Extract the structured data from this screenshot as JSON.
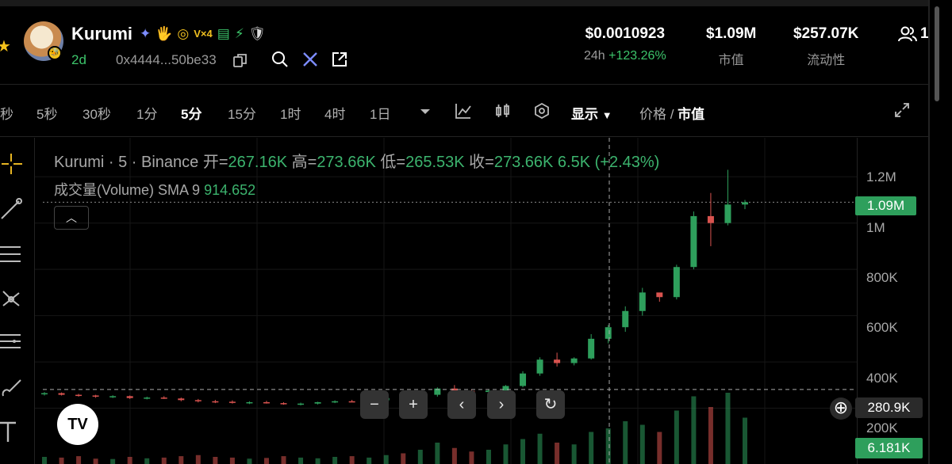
{
  "token": {
    "name": "Kurumi",
    "age": "2d",
    "address": "0x4444...50be33",
    "avatar_badge": "🐝"
  },
  "badges": [
    "✦",
    "🖐",
    "◎",
    "V×4",
    "▤",
    "⚡",
    "🛡"
  ],
  "stats": {
    "price": "$0.0010923",
    "change_label": "24h",
    "change_value": "+123.26%",
    "market_cap": "$1.09M",
    "market_cap_label": "市值",
    "liquidity": "$257.07K",
    "liquidity_label": "流动性",
    "holders": "1"
  },
  "toolbar": {
    "timeframes": [
      "秒",
      "5秒",
      "30秒",
      "1分",
      "5分",
      "15分",
      "1时",
      "4时",
      "1日"
    ],
    "active_timeframe": "5分",
    "display_label": "显示",
    "price_label": "价格",
    "mc_label": "市值"
  },
  "legend": {
    "symbol": "Kurumi · 5 · Binance",
    "open_label": "开=",
    "open": "267.16K",
    "high_label": "高=",
    "high": "273.66K",
    "low_label": "低=",
    "low": "265.53K",
    "close_label": "收=",
    "close": "273.66K",
    "change": "6.5K (+2.43%)",
    "volume_label": "成交量(Volume) SMA 9",
    "volume_value": "914.652"
  },
  "axis": {
    "ticks": [
      "1.2M",
      "1M",
      "800K",
      "600K",
      "400K",
      "200K"
    ],
    "current_price": "1.09M",
    "crosshair_value": "280.9K",
    "volume_current": "6.181K"
  },
  "colors": {
    "up": "#2e9f5c",
    "down": "#d9534f",
    "accent_green": "#3cc36a"
  },
  "chart_data": {
    "type": "candlestick",
    "title": "Kurumi · 5 · Binance",
    "ylim": [
      0,
      1300000
    ],
    "y_ticks": [
      200000,
      400000,
      600000,
      800000,
      1000000,
      1200000
    ],
    "ohlc": [
      [
        260000,
        270000,
        255000,
        265000
      ],
      [
        265000,
        268000,
        255000,
        258000
      ],
      [
        258000,
        262000,
        250000,
        255000
      ],
      [
        255000,
        258000,
        245000,
        250000
      ],
      [
        250000,
        256000,
        244000,
        252000
      ],
      [
        252000,
        255000,
        240000,
        244000
      ],
      [
        244000,
        250000,
        238000,
        246000
      ],
      [
        246000,
        252000,
        240000,
        242000
      ],
      [
        242000,
        246000,
        230000,
        235000
      ],
      [
        235000,
        240000,
        225000,
        230000
      ],
      [
        230000,
        236000,
        222000,
        228000
      ],
      [
        228000,
        234000,
        220000,
        224000
      ],
      [
        224000,
        230000,
        218000,
        226000
      ],
      [
        226000,
        232000,
        220000,
        222000
      ],
      [
        222000,
        226000,
        215000,
        218000
      ],
      [
        218000,
        224000,
        212000,
        220000
      ],
      [
        220000,
        228000,
        216000,
        226000
      ],
      [
        226000,
        234000,
        222000,
        230000
      ],
      [
        230000,
        236000,
        226000,
        228000
      ],
      [
        228000,
        236000,
        224000,
        234000
      ],
      [
        234000,
        246000,
        230000,
        244000
      ],
      [
        244000,
        252000,
        238000,
        240000
      ],
      [
        240000,
        262000,
        238000,
        258000
      ],
      [
        258000,
        290000,
        250000,
        285000
      ],
      [
        285000,
        300000,
        270000,
        275000
      ],
      [
        275000,
        282000,
        265000,
        270000
      ],
      [
        270000,
        280000,
        262000,
        276000
      ],
      [
        276000,
        300000,
        272000,
        296000
      ],
      [
        296000,
        360000,
        290000,
        350000
      ],
      [
        350000,
        420000,
        340000,
        410000
      ],
      [
        410000,
        440000,
        380000,
        395000
      ],
      [
        395000,
        420000,
        385000,
        415000
      ],
      [
        415000,
        520000,
        410000,
        500000
      ],
      [
        500000,
        560000,
        480000,
        550000
      ],
      [
        550000,
        640000,
        530000,
        620000
      ],
      [
        620000,
        720000,
        600000,
        700000
      ],
      [
        700000,
        690000,
        660000,
        680000
      ],
      [
        680000,
        820000,
        670000,
        810000
      ],
      [
        810000,
        1050000,
        800000,
        1030000
      ],
      [
        1030000,
        1130000,
        900000,
        1000000
      ],
      [
        1000000,
        1230000,
        990000,
        1080000
      ],
      [
        1080000,
        1100000,
        1060000,
        1090000
      ]
    ],
    "volume": [
      20,
      18,
      22,
      15,
      14,
      20,
      16,
      18,
      22,
      25,
      20,
      18,
      15,
      17,
      22,
      18,
      16,
      20,
      22,
      18,
      25,
      30,
      40,
      60,
      45,
      35,
      40,
      55,
      70,
      85,
      60,
      55,
      90,
      100,
      120,
      110,
      90,
      150,
      190,
      160,
      200,
      130
    ]
  }
}
